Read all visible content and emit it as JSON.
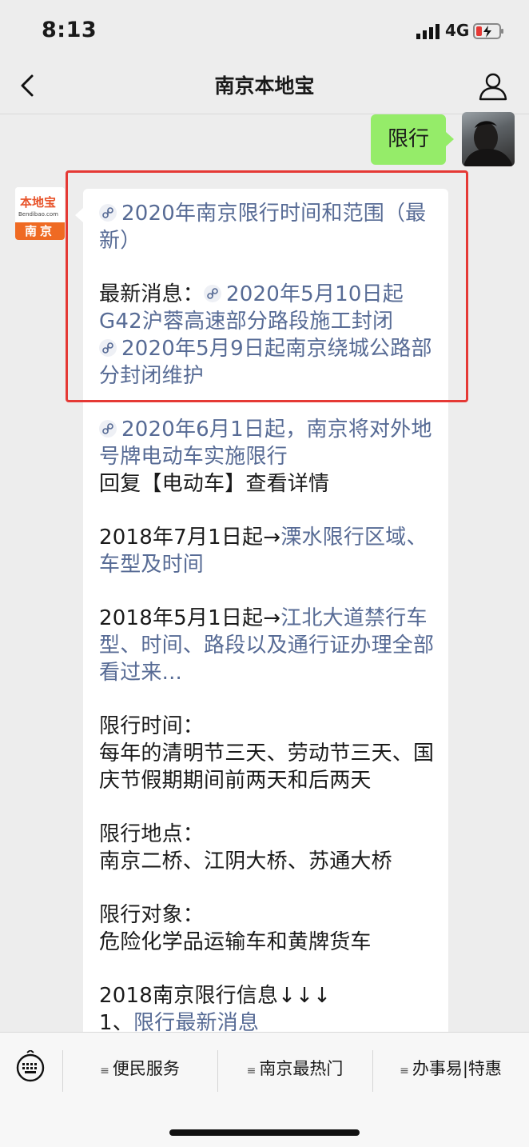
{
  "status_bar": {
    "time": "8:13",
    "network": "4G"
  },
  "header": {
    "title": "南京本地宝"
  },
  "user_message": {
    "text": "限行"
  },
  "bot": {
    "logo_main": "本地宝",
    "logo_url": "Bendibao.com",
    "logo_city": "南京"
  },
  "reply": {
    "item1_link": "2020年南京限行时间和范围（最新）",
    "item2_label": "最新消息：",
    "item2_link": "2020年5月10日起G42沪蓉高速部分路段施工封闭",
    "item3_link": "2020年5月9日起南京绕城公路部分封闭维护",
    "item4_link": "2020年6月1日起，南京将对外地号牌电动车实施限行",
    "item4_text": "回复【电动车】查看详情",
    "item5_prefix": "2018年7月1日起→",
    "item5_link": "溧水限行区域、车型及时间",
    "item6_prefix": "2018年5月1日起→",
    "item6_link": "江北大道禁行车型、时间、路段以及通行证办理全部看过来...",
    "time_label": "限行时间：",
    "time_text": "每年的清明节三天、劳动节三天、国庆节假期期间前两天和后两天",
    "place_label": "限行地点：",
    "place_text": "南京二桥、江阴大桥、苏通大桥",
    "object_label": "限行对象：",
    "object_text": "危险化学品运输车和黄牌货车",
    "info_2018": "2018南京限行信息↓↓↓",
    "item_num1": "1、",
    "item_num1_link": "限行最新消息"
  },
  "menu": {
    "items": [
      "便民服务",
      "南京最热门",
      "办事易|特惠"
    ]
  },
  "colors": {
    "accent_link": "#576b95",
    "bubble_green": "#95ec69",
    "highlight_red": "#e53935",
    "logo_orange": "#ef6a23"
  },
  "icons": [
    "back-arrow-icon",
    "profile-icon",
    "keyboard-icon",
    "mini-program-icon",
    "menu-bars-icon",
    "signal-icon",
    "battery-icon"
  ]
}
